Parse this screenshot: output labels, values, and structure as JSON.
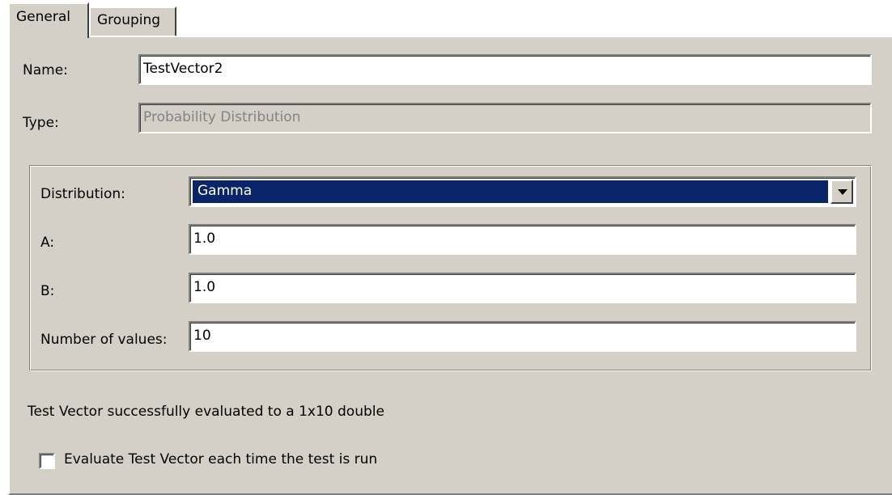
{
  "tabs": {
    "general": "General",
    "grouping": "Grouping"
  },
  "form": {
    "name_label": "Name:",
    "name_value": "TestVector2",
    "type_label": "Type:",
    "type_value": "Probability Distribution"
  },
  "distribution": {
    "label": "Distribution:",
    "selected": "Gamma",
    "a_label": "A:",
    "a_value": "1.0",
    "b_label": "B:",
    "b_value": "1.0",
    "count_label": "Number of values:",
    "count_value": "10"
  },
  "status": {
    "message": "Test Vector successfully evaluated to a 1x10 double"
  },
  "options": {
    "evaluate_label": "Evaluate Test Vector each time the test is run",
    "evaluate_checked": false
  },
  "icons": {
    "dropdown": "chevron-down-icon"
  },
  "colors": {
    "panel_background": "#d4d0c8",
    "selection_background": "#0a246a",
    "selection_text": "#ffffff",
    "disabled_text": "#848284"
  }
}
